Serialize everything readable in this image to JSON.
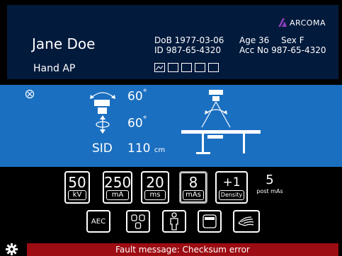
{
  "brand": {
    "name": "ARCOMA",
    "color": "#8b3fb8"
  },
  "patient": {
    "name": "Jane Doe",
    "exam": "Hand AP",
    "dob": "DoB 1977-03-06",
    "id": "ID 987-65-4320",
    "age": "Age 36",
    "sex": "Sex F",
    "acc": "Acc No 987-65-4320"
  },
  "geometry": {
    "tube_angle": "60",
    "rotation_angle": "60",
    "degree_symbol": "°",
    "sid_label": "SID",
    "sid_value": "110",
    "sid_unit": "cm"
  },
  "params": [
    {
      "value": "50",
      "label": "kV"
    },
    {
      "value": "250",
      "label": "mA"
    },
    {
      "value": "20",
      "label": "ms"
    },
    {
      "value": "8",
      "label": "mAs"
    },
    {
      "value": "+1",
      "label": "Density"
    }
  ],
  "post_mas": {
    "value": "5",
    "label": "post mAs"
  },
  "modes": {
    "aec_label": "AEC"
  },
  "fault": {
    "message": "Fault message: Checksum error"
  },
  "colors": {
    "header_bg": "#021a3c",
    "geometry_bg": "#1b6fc0",
    "fault_bg": "#9c0c12"
  }
}
